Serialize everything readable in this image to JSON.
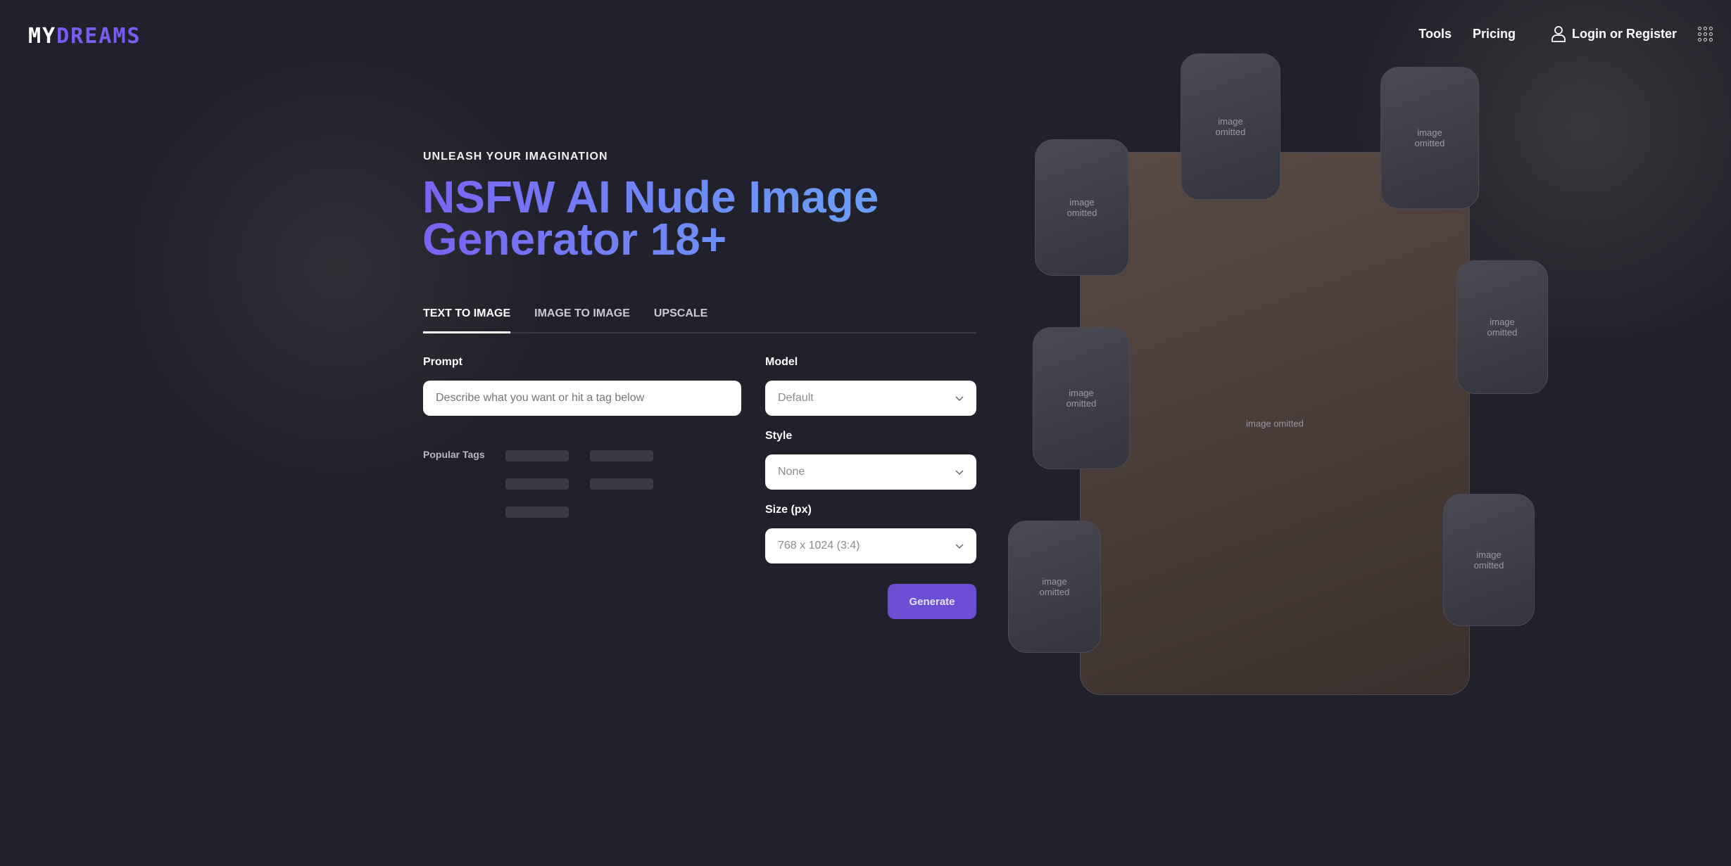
{
  "header": {
    "logo": {
      "part1": "MY",
      "part2": "DREAMS"
    },
    "nav": [
      {
        "label": "Tools"
      },
      {
        "label": "Pricing"
      }
    ],
    "login_label": "Login or Register"
  },
  "hero": {
    "eyebrow": "UNLEASH YOUR IMAGINATION",
    "title": "NSFW AI Nude Image Generator 18+"
  },
  "tabs": [
    {
      "label": "TEXT TO IMAGE",
      "active": true
    },
    {
      "label": "IMAGE TO IMAGE",
      "active": false
    },
    {
      "label": "UPSCALE",
      "active": false
    }
  ],
  "form": {
    "prompt_label": "Prompt",
    "prompt_placeholder": "Describe what you want or hit a tag below",
    "popular_tags_label": "Popular Tags",
    "popular_tags_note": "[celebrity name tags omitted]",
    "model_label": "Model",
    "model_value": "Default",
    "style_label": "Style",
    "style_value": "None",
    "size_label": "Size (px)",
    "size_value": "768 x 1024 (3:4)",
    "generate_label": "Generate"
  },
  "colors": {
    "background": "#21212b",
    "accent": "#6c4dd3",
    "logo_accent": "#7b5cf0"
  },
  "collage": {
    "placeholder_label": "image omitted"
  }
}
